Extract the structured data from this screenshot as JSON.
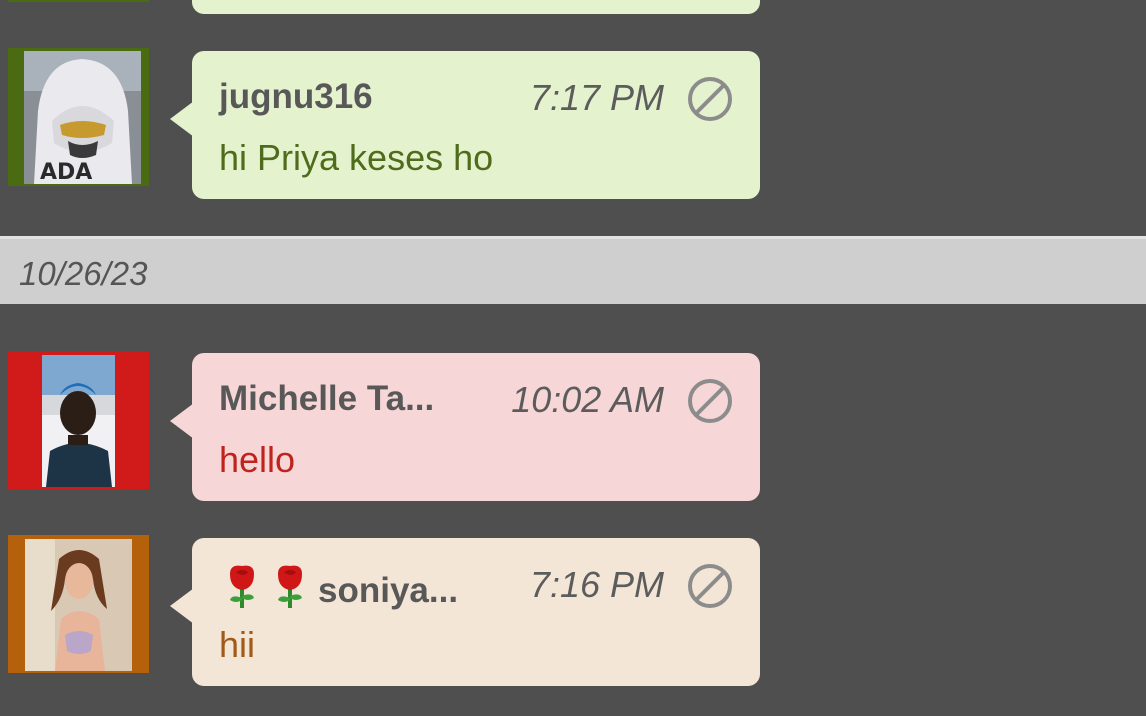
{
  "date_separator": "10/26/23",
  "messages": [
    {
      "sender": "jugnu316",
      "time": "7:17 PM",
      "text": "hi Priya keses ho",
      "avatar_border": "#4b6b12",
      "bubble_color": "#e4f3cd",
      "text_color": "#4f6b1c",
      "block_icon": "block-icon"
    },
    {
      "sender": "Michelle Ta...",
      "time": "10:02 AM",
      "text": "hello",
      "avatar_border": "#d11a1a",
      "bubble_color": "#f6d6d6",
      "text_color": "#c0231d",
      "block_icon": "block-icon"
    },
    {
      "sender_prefix_icons": [
        "rose-icon",
        "rose-icon"
      ],
      "sender": "soniya...",
      "time": "7:16 PM",
      "text": "hii",
      "avatar_border": "#b5610b",
      "bubble_color": "#f3e6d7",
      "text_color": "#a25a17",
      "block_icon": "block-icon"
    }
  ],
  "colors": {
    "background": "#4f4f4f",
    "date_bar": "#cfcfcf"
  }
}
